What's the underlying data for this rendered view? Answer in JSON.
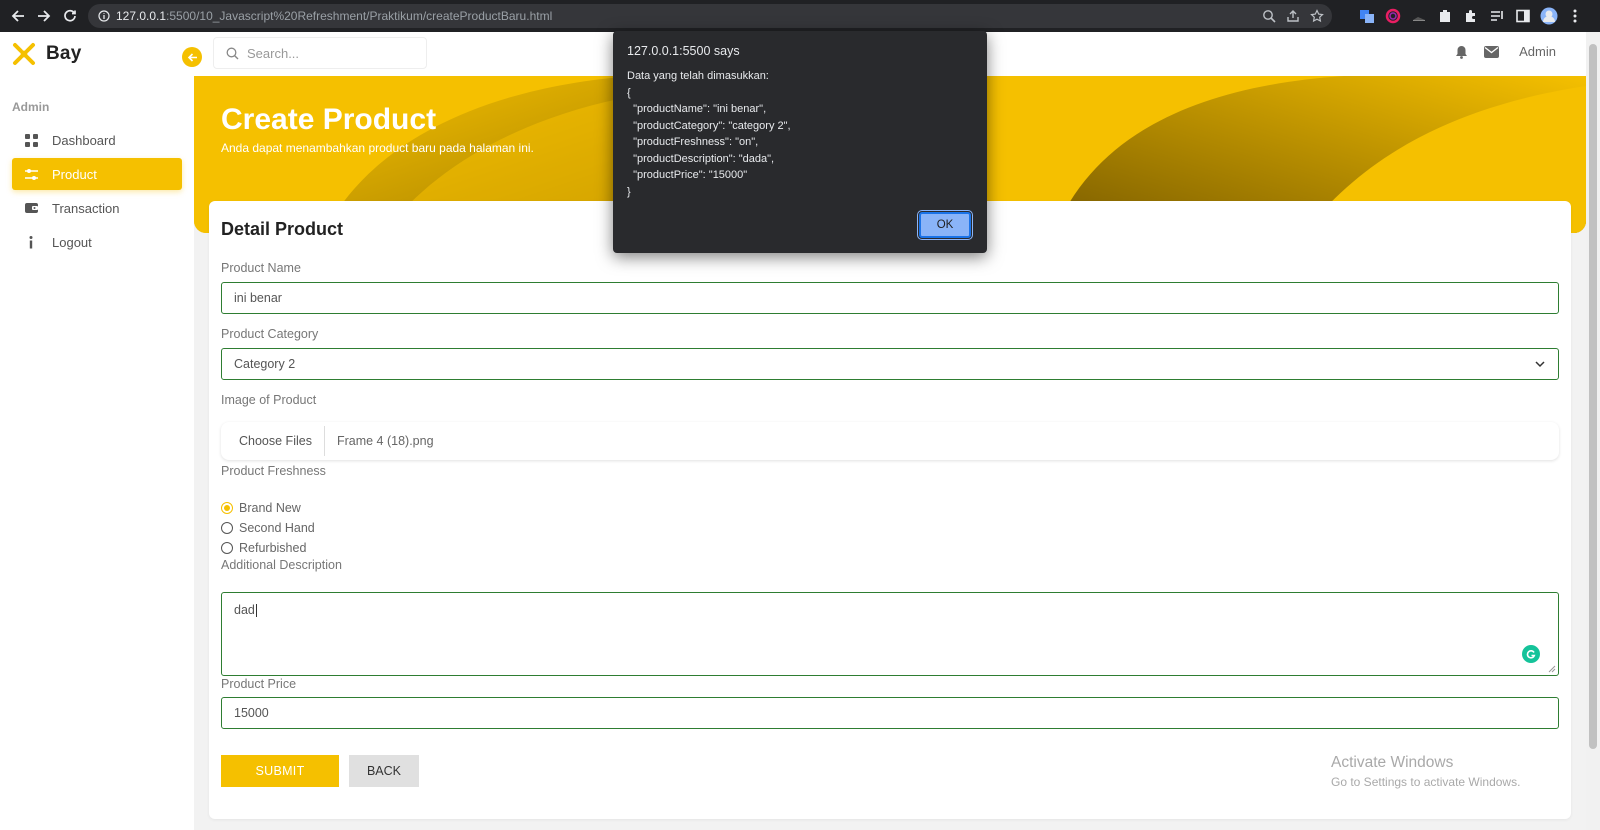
{
  "browser": {
    "url_host": "127.0.0.1",
    "url_rest": ":5500/10_Javascript%20Refreshment/Praktikum/createProductBaru.html"
  },
  "sidebar": {
    "brand": "Bay",
    "section": "Admin",
    "items": [
      {
        "label": "Dashboard",
        "icon": "grid-icon"
      },
      {
        "label": "Product",
        "icon": "sliders-icon",
        "active": true
      },
      {
        "label": "Transaction",
        "icon": "wallet-icon"
      },
      {
        "label": "Logout",
        "icon": "info-icon"
      }
    ]
  },
  "header": {
    "search_placeholder": "Search...",
    "user": "Admin"
  },
  "banner": {
    "title": "Create Product",
    "subtitle": "Anda dapat menambahkan product baru pada halaman ini."
  },
  "form": {
    "title": "Detail Product",
    "product_name_label": "Product Name",
    "product_name_value": "ini benar",
    "category_label": "Product Category",
    "category_value": "Category 2",
    "image_label": "Image of Product",
    "file_button": "Choose Files",
    "file_name": "Frame 4 (18).png",
    "freshness_label": "Product Freshness",
    "freshness_options": [
      "Brand New",
      "Second Hand",
      "Refurbished"
    ],
    "freshness_selected": "Brand New",
    "description_label": "Additional Description",
    "description_value": "dad",
    "price_label": "Product Price",
    "price_value": "15000",
    "submit_label": "SUBMIT",
    "back_label": "BACK"
  },
  "watermark": {
    "title": "Activate Windows",
    "subtitle": "Go to Settings to activate Windows."
  },
  "dialog": {
    "title": "127.0.0.1:5500 says",
    "message": "Data yang telah dimasukkan:\n{\n  \"productName\": \"ini benar\",\n  \"productCategory\": \"category 2\",\n  \"productFreshness\": \"on\",\n  \"productDescription\": \"dada\",\n  \"productPrice\": \"15000\"\n}",
    "ok_label": "OK"
  },
  "colors": {
    "accent": "#f5c000",
    "input_border": "#2e7d32",
    "dialog_bg": "#292a2d"
  }
}
